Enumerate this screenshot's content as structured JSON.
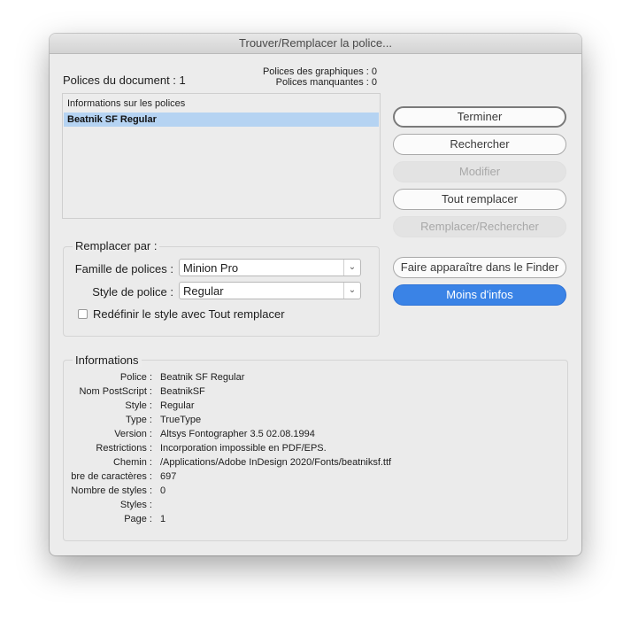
{
  "window": {
    "title": "Trouver/Remplacer la police..."
  },
  "summary": {
    "doc_fonts": "Polices du document : 1",
    "graphic_fonts": "Polices des graphiques : 0",
    "missing_fonts": "Polices manquantes : 0"
  },
  "font_list": {
    "header": "Informations sur les polices",
    "items": [
      "Beatnik SF Regular"
    ]
  },
  "buttons": {
    "done": "Terminer",
    "find": "Rechercher",
    "modify": "Modifier",
    "replace_all": "Tout remplacer",
    "replace_find": "Remplacer/Rechercher",
    "reveal_finder": "Faire apparaître dans le Finder",
    "less_info": "Moins d'infos"
  },
  "replace_with": {
    "legend": "Remplacer par :",
    "family_label": "Famille de polices :",
    "family_value": "Minion Pro",
    "style_label": "Style de police :",
    "style_value": "Regular",
    "redefine_label": "Redéfinir le style avec Tout remplacer",
    "redefine_checked": false
  },
  "info": {
    "legend": "Informations",
    "rows": [
      {
        "key": "Police :",
        "value": "Beatnik SF Regular"
      },
      {
        "key": "Nom PostScript :",
        "value": "BeatnikSF"
      },
      {
        "key": "Style :",
        "value": "Regular"
      },
      {
        "key": "Type :",
        "value": "TrueType"
      },
      {
        "key": "Version :",
        "value": "Altsys Fontographer 3.5  02.08.1994"
      },
      {
        "key": "Restrictions :",
        "value": "Incorporation impossible en PDF/EPS."
      },
      {
        "key": "Chemin :",
        "value": "/Applications/Adobe InDesign 2020/Fonts/beatniksf.ttf"
      },
      {
        "key": "bre de caractères :",
        "value": "697"
      },
      {
        "key": "Nombre de styles :",
        "value": "0"
      },
      {
        "key": "Styles :",
        "value": ""
      },
      {
        "key": "Page :",
        "value": "1"
      }
    ]
  },
  "icons": {
    "select_arrow": "chevron-updown-icon"
  }
}
